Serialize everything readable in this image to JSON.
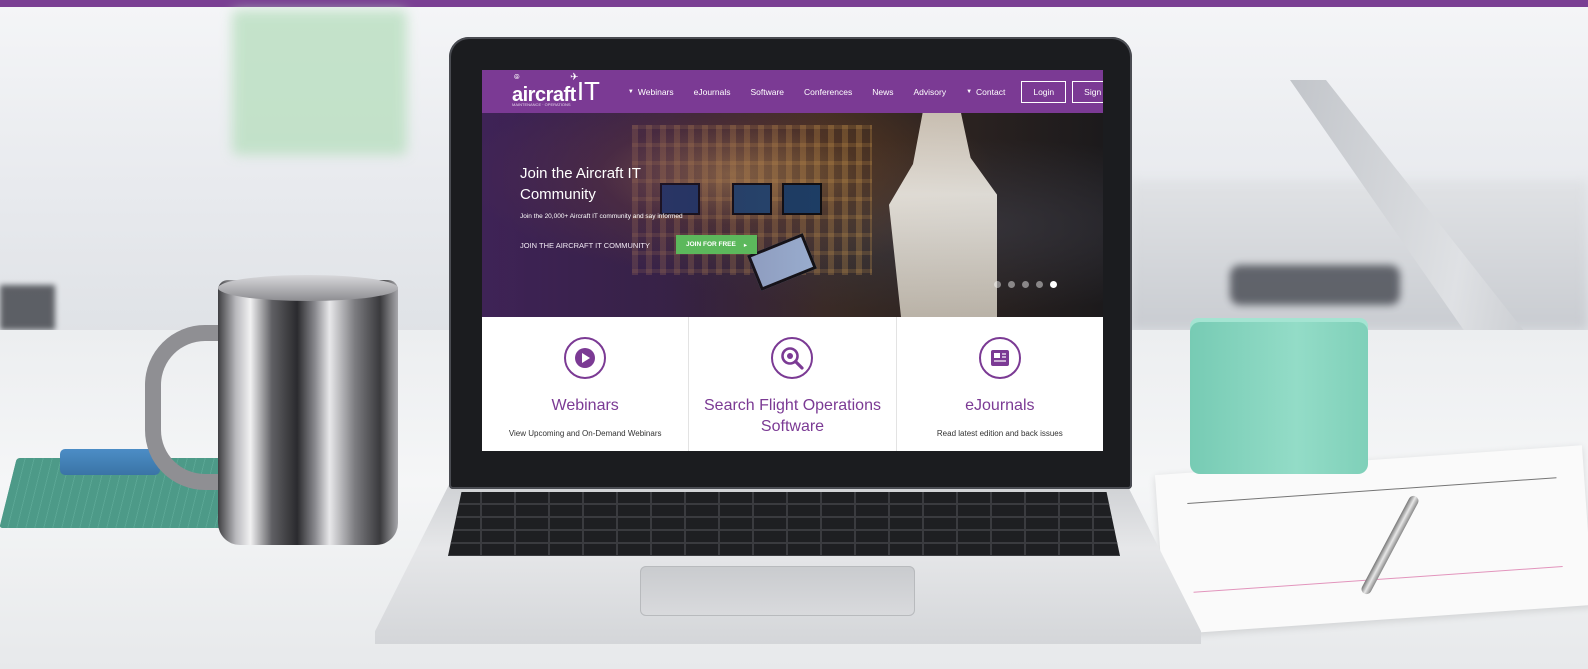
{
  "site": {
    "logo": {
      "word": "aircraft",
      "suffix": "IT",
      "tagline": "MAINTENANCE · OPERATIONS"
    },
    "nav": {
      "items": [
        {
          "label": "Webinars",
          "has_caret": true
        },
        {
          "label": "eJournals",
          "has_caret": false
        },
        {
          "label": "Software",
          "has_caret": false
        },
        {
          "label": "Conferences",
          "has_caret": false
        },
        {
          "label": "News",
          "has_caret": false
        },
        {
          "label": "Advisory",
          "has_caret": false
        },
        {
          "label": "Contact",
          "has_caret": true
        }
      ],
      "login_label": "Login",
      "signup_label": "Sign Up"
    },
    "hero": {
      "title": "Join the Aircraft IT Community",
      "subtitle": "Join the 20,000+ Aircraft IT community and say informed",
      "cta_text": "JOIN THE AIRCRAFT IT COMMUNITY",
      "join_button": "JOIN FOR FREE",
      "join_arrow": "▸",
      "carousel": {
        "slides": 5,
        "active_index": 4
      }
    },
    "features": [
      {
        "icon": "play-icon",
        "title": "Webinars",
        "desc": "View Upcoming and On-Demand Webinars"
      },
      {
        "icon": "search-icon",
        "title": "Search Flight Operations Software",
        "desc": ""
      },
      {
        "icon": "journal-icon",
        "title": "eJournals",
        "desc": "Read latest edition and back issues"
      }
    ]
  },
  "colors": {
    "brand_purple": "#7b3a94",
    "join_green": "#5cb85c",
    "top_bar": "#7a3f93"
  }
}
